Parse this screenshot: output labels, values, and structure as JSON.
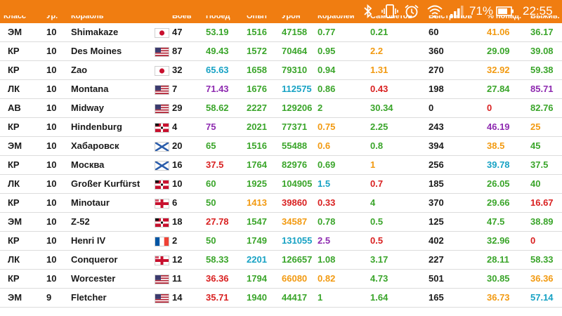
{
  "status_bar": {
    "battery": "71%",
    "time": "22:55"
  },
  "colors": {
    "header": "#f07d11",
    "green": "#3aa52a",
    "cyan": "#17a2c4",
    "purple": "#8e2ab0",
    "orange": "#f29a11",
    "red": "#d92020",
    "black": "#1a1a1a"
  },
  "columns": [
    "Класс",
    "Ур.",
    "Корабль",
    "",
    "Боёв",
    "Побед",
    "Опыт",
    "Урон",
    "Кораблей",
    "Самолетов",
    "Выстрелов",
    "% попад.",
    "Выжив."
  ],
  "rows": [
    {
      "cls": "ЭМ",
      "tier": "10",
      "ship": "Shimakaze",
      "flag": "jp",
      "battles": "47",
      "wins": {
        "v": "53.19",
        "c": "green"
      },
      "exp": {
        "v": "1516",
        "c": "green"
      },
      "dmg": {
        "v": "47158",
        "c": "green"
      },
      "ships": {
        "v": "0.77",
        "c": "green"
      },
      "planes": {
        "v": "0.21",
        "c": "green"
      },
      "shots": "60",
      "acc": {
        "v": "41.06",
        "c": "orange"
      },
      "surv": {
        "v": "36.17",
        "c": "green"
      }
    },
    {
      "cls": "КР",
      "tier": "10",
      "ship": "Des Moines",
      "flag": "us",
      "battles": "87",
      "wins": {
        "v": "49.43",
        "c": "green"
      },
      "exp": {
        "v": "1572",
        "c": "green"
      },
      "dmg": {
        "v": "70464",
        "c": "green"
      },
      "ships": {
        "v": "0.95",
        "c": "green"
      },
      "planes": {
        "v": "2.2",
        "c": "orange"
      },
      "shots": "360",
      "acc": {
        "v": "29.09",
        "c": "green"
      },
      "surv": {
        "v": "39.08",
        "c": "green"
      }
    },
    {
      "cls": "КР",
      "tier": "10",
      "ship": "Zao",
      "flag": "jp",
      "battles": "32",
      "wins": {
        "v": "65.63",
        "c": "cyan"
      },
      "exp": {
        "v": "1658",
        "c": "green"
      },
      "dmg": {
        "v": "79310",
        "c": "green"
      },
      "ships": {
        "v": "0.94",
        "c": "green"
      },
      "planes": {
        "v": "1.31",
        "c": "orange"
      },
      "shots": "270",
      "acc": {
        "v": "32.92",
        "c": "orange"
      },
      "surv": {
        "v": "59.38",
        "c": "green"
      }
    },
    {
      "cls": "ЛК",
      "tier": "10",
      "ship": "Montana",
      "flag": "us",
      "battles": "7",
      "wins": {
        "v": "71.43",
        "c": "purple"
      },
      "exp": {
        "v": "1676",
        "c": "green"
      },
      "dmg": {
        "v": "112575",
        "c": "cyan"
      },
      "ships": {
        "v": "0.86",
        "c": "green"
      },
      "planes": {
        "v": "0.43",
        "c": "red"
      },
      "shots": "198",
      "acc": {
        "v": "27.84",
        "c": "green"
      },
      "surv": {
        "v": "85.71",
        "c": "purple"
      }
    },
    {
      "cls": "АВ",
      "tier": "10",
      "ship": "Midway",
      "flag": "us",
      "battles": "29",
      "wins": {
        "v": "58.62",
        "c": "green"
      },
      "exp": {
        "v": "2227",
        "c": "green"
      },
      "dmg": {
        "v": "129206",
        "c": "green"
      },
      "ships": {
        "v": "2",
        "c": "green"
      },
      "planes": {
        "v": "30.34",
        "c": "green"
      },
      "shots": "0",
      "acc": {
        "v": "0",
        "c": "red"
      },
      "surv": {
        "v": "82.76",
        "c": "green"
      }
    },
    {
      "cls": "КР",
      "tier": "10",
      "ship": "Hindenburg",
      "flag": "de",
      "battles": "4",
      "wins": {
        "v": "75",
        "c": "purple"
      },
      "exp": {
        "v": "2021",
        "c": "green"
      },
      "dmg": {
        "v": "77371",
        "c": "green"
      },
      "ships": {
        "v": "0.75",
        "c": "orange"
      },
      "planes": {
        "v": "2.25",
        "c": "green"
      },
      "shots": "243",
      "acc": {
        "v": "46.19",
        "c": "purple"
      },
      "surv": {
        "v": "25",
        "c": "orange"
      }
    },
    {
      "cls": "ЭМ",
      "tier": "10",
      "ship": "Хабаровск",
      "flag": "ru",
      "battles": "20",
      "wins": {
        "v": "65",
        "c": "green"
      },
      "exp": {
        "v": "1516",
        "c": "green"
      },
      "dmg": {
        "v": "55488",
        "c": "green"
      },
      "ships": {
        "v": "0.6",
        "c": "orange"
      },
      "planes": {
        "v": "0.8",
        "c": "green"
      },
      "shots": "394",
      "acc": {
        "v": "38.5",
        "c": "orange"
      },
      "surv": {
        "v": "45",
        "c": "green"
      }
    },
    {
      "cls": "КР",
      "tier": "10",
      "ship": "Москва",
      "flag": "ru",
      "battles": "16",
      "wins": {
        "v": "37.5",
        "c": "red"
      },
      "exp": {
        "v": "1764",
        "c": "green"
      },
      "dmg": {
        "v": "82976",
        "c": "green"
      },
      "ships": {
        "v": "0.69",
        "c": "green"
      },
      "planes": {
        "v": "1",
        "c": "orange"
      },
      "shots": "256",
      "acc": {
        "v": "39.78",
        "c": "cyan"
      },
      "surv": {
        "v": "37.5",
        "c": "green"
      }
    },
    {
      "cls": "ЛК",
      "tier": "10",
      "ship": "Großer Kurfürst",
      "flag": "de",
      "battles": "10",
      "wins": {
        "v": "60",
        "c": "green"
      },
      "exp": {
        "v": "1925",
        "c": "green"
      },
      "dmg": {
        "v": "104905",
        "c": "green"
      },
      "ships": {
        "v": "1.5",
        "c": "cyan"
      },
      "planes": {
        "v": "0.7",
        "c": "red"
      },
      "shots": "185",
      "acc": {
        "v": "26.05",
        "c": "green"
      },
      "surv": {
        "v": "40",
        "c": "green"
      }
    },
    {
      "cls": "КР",
      "tier": "10",
      "ship": "Minotaur",
      "flag": "uk",
      "battles": "6",
      "wins": {
        "v": "50",
        "c": "green"
      },
      "exp": {
        "v": "1413",
        "c": "orange"
      },
      "dmg": {
        "v": "39860",
        "c": "red"
      },
      "ships": {
        "v": "0.33",
        "c": "red"
      },
      "planes": {
        "v": "4",
        "c": "green"
      },
      "shots": "370",
      "acc": {
        "v": "29.66",
        "c": "green"
      },
      "surv": {
        "v": "16.67",
        "c": "red"
      }
    },
    {
      "cls": "ЭМ",
      "tier": "10",
      "ship": "Z-52",
      "flag": "de",
      "battles": "18",
      "wins": {
        "v": "27.78",
        "c": "red"
      },
      "exp": {
        "v": "1547",
        "c": "green"
      },
      "dmg": {
        "v": "34587",
        "c": "orange"
      },
      "ships": {
        "v": "0.78",
        "c": "green"
      },
      "planes": {
        "v": "0.5",
        "c": "green"
      },
      "shots": "125",
      "acc": {
        "v": "47.5",
        "c": "green"
      },
      "surv": {
        "v": "38.89",
        "c": "green"
      }
    },
    {
      "cls": "КР",
      "tier": "10",
      "ship": "Henri IV",
      "flag": "fr",
      "battles": "2",
      "wins": {
        "v": "50",
        "c": "green"
      },
      "exp": {
        "v": "1749",
        "c": "green"
      },
      "dmg": {
        "v": "131055",
        "c": "cyan"
      },
      "ships": {
        "v": "2.5",
        "c": "purple"
      },
      "planes": {
        "v": "0.5",
        "c": "red"
      },
      "shots": "402",
      "acc": {
        "v": "32.96",
        "c": "green"
      },
      "surv": {
        "v": "0",
        "c": "red"
      }
    },
    {
      "cls": "ЛК",
      "tier": "10",
      "ship": "Conqueror",
      "flag": "uk",
      "battles": "12",
      "wins": {
        "v": "58.33",
        "c": "green"
      },
      "exp": {
        "v": "2201",
        "c": "cyan"
      },
      "dmg": {
        "v": "126657",
        "c": "green"
      },
      "ships": {
        "v": "1.08",
        "c": "green"
      },
      "planes": {
        "v": "3.17",
        "c": "green"
      },
      "shots": "227",
      "acc": {
        "v": "28.11",
        "c": "green"
      },
      "surv": {
        "v": "58.33",
        "c": "green"
      }
    },
    {
      "cls": "КР",
      "tier": "10",
      "ship": "Worcester",
      "flag": "us",
      "battles": "11",
      "wins": {
        "v": "36.36",
        "c": "red"
      },
      "exp": {
        "v": "1794",
        "c": "green"
      },
      "dmg": {
        "v": "66080",
        "c": "orange"
      },
      "ships": {
        "v": "0.82",
        "c": "orange"
      },
      "planes": {
        "v": "4.73",
        "c": "green"
      },
      "shots": "501",
      "acc": {
        "v": "30.85",
        "c": "green"
      },
      "surv": {
        "v": "36.36",
        "c": "orange"
      }
    },
    {
      "cls": "ЭМ",
      "tier": "9",
      "ship": "Fletcher",
      "flag": "us",
      "battles": "14",
      "wins": {
        "v": "35.71",
        "c": "red"
      },
      "exp": {
        "v": "1940",
        "c": "green"
      },
      "dmg": {
        "v": "44417",
        "c": "green"
      },
      "ships": {
        "v": "1",
        "c": "green"
      },
      "planes": {
        "v": "1.64",
        "c": "green"
      },
      "shots": "165",
      "acc": {
        "v": "36.73",
        "c": "orange"
      },
      "surv": {
        "v": "57.14",
        "c": "cyan"
      }
    }
  ]
}
